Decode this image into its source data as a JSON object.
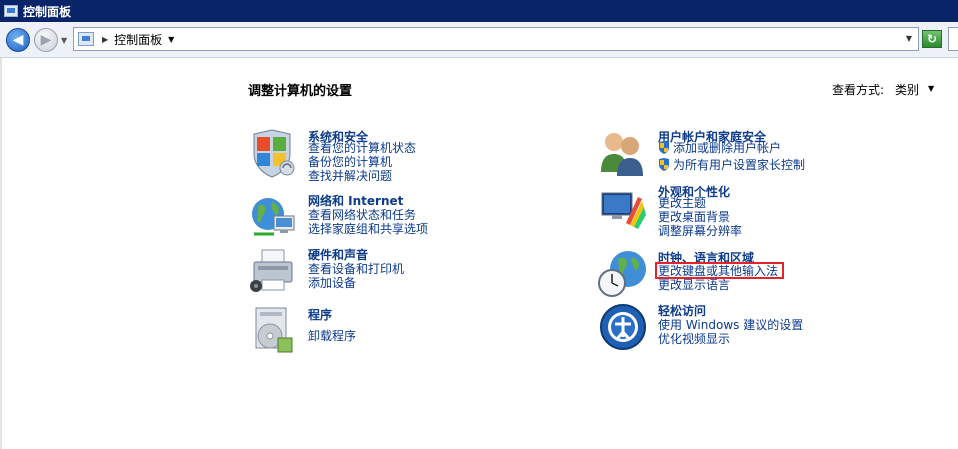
{
  "window": {
    "title": "控制面板"
  },
  "address": {
    "path_label": "控制面板"
  },
  "main": {
    "heading": "调整计算机的设置",
    "view_by_label": "查看方式:",
    "view_by_value": "类别"
  },
  "categories": [
    {
      "title": "系统和安全",
      "icon": "shield-icon",
      "links": [
        "查看您的计算机状态",
        "备份您的计算机",
        "查找并解决问题"
      ]
    },
    {
      "title": "网络和 Internet",
      "icon": "network-globe-icon",
      "links": [
        "查看网络状态和任务",
        "选择家庭组和共享选项"
      ]
    },
    {
      "title": "硬件和声音",
      "icon": "printer-icon",
      "links": [
        "查看设备和打印机",
        "添加设备"
      ]
    },
    {
      "title": "程序",
      "icon": "programs-disc-icon",
      "links": [
        "卸载程序"
      ]
    },
    {
      "title": "用户帐户和家庭安全",
      "icon": "users-icon",
      "links": [
        "添加或删除用户帐户",
        "为所有用户设置家长控制"
      ]
    },
    {
      "title": "外观和个性化",
      "icon": "appearance-monitor-icon",
      "links": [
        "更改主题",
        "更改桌面背景",
        "调整屏幕分辨率"
      ]
    },
    {
      "title": "时钟、语言和区域",
      "icon": "clock-globe-icon",
      "links": [
        "更改键盘或其他输入法",
        "更改显示语言"
      ]
    },
    {
      "title": "轻松访问",
      "icon": "ease-of-access-icon",
      "links": [
        "使用 Windows 建议的设置",
        "优化视频显示"
      ]
    }
  ],
  "highlight_color": "#e0242a",
  "title_bar_color": "#0a246a"
}
